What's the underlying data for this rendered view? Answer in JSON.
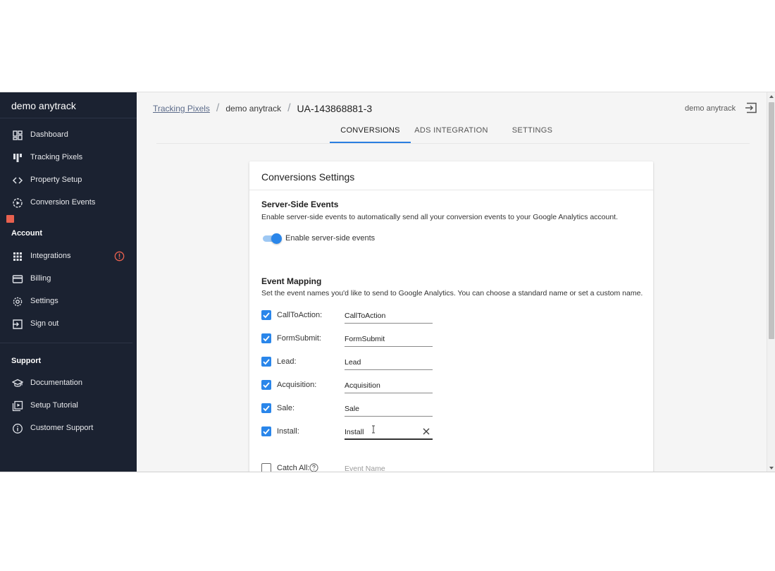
{
  "sidebar": {
    "brand": "demo anytrack",
    "nav": [
      {
        "label": "Dashboard",
        "icon": "dashboard-icon"
      },
      {
        "label": "Tracking Pixels",
        "icon": "pixel-icon"
      },
      {
        "label": "Property Setup",
        "icon": "code-icon"
      },
      {
        "label": "Conversion Events",
        "icon": "events-icon"
      }
    ],
    "account_title": "Account",
    "account": [
      {
        "label": "Integrations",
        "icon": "apps-grid-icon",
        "alert": true
      },
      {
        "label": "Billing",
        "icon": "credit-card-icon"
      },
      {
        "label": "Settings",
        "icon": "gear-icon"
      },
      {
        "label": "Sign out",
        "icon": "sign-out-icon"
      }
    ],
    "support_title": "Support",
    "support": [
      {
        "label": "Documentation",
        "icon": "graduation-cap-icon"
      },
      {
        "label": "Setup Tutorial",
        "icon": "video-library-icon"
      },
      {
        "label": "Customer Support",
        "icon": "info-icon"
      }
    ]
  },
  "header": {
    "breadcrumb": {
      "link": "Tracking Pixels",
      "middle": "demo anytrack",
      "current": "UA-143868881-3"
    },
    "user": "demo anytrack"
  },
  "tabs": [
    {
      "label": "CONVERSIONS",
      "active": true
    },
    {
      "label": "ADS INTEGRATION",
      "active": false
    },
    {
      "label": "SETTINGS",
      "active": false
    }
  ],
  "card": {
    "title": "Conversions Settings",
    "server_side": {
      "heading": "Server-Side Events",
      "description": "Enable server-side events to automatically send all your conversion events to your Google Analytics account.",
      "toggle_label": "Enable server-side events",
      "enabled": true
    },
    "mapping": {
      "heading": "Event Mapping",
      "description": "Set the event names you'd like to send to Google Analytics. You can choose a standard name or set a custom name.",
      "rows": [
        {
          "name": "CallToAction:",
          "value": "CallToAction",
          "checked": true
        },
        {
          "name": "FormSubmit:",
          "value": "FormSubmit",
          "checked": true
        },
        {
          "name": "Lead:",
          "value": "Lead",
          "checked": true
        },
        {
          "name": "Acquisition:",
          "value": "Acquisition",
          "checked": true
        },
        {
          "name": "Sale:",
          "value": "Sale",
          "checked": true
        },
        {
          "name": "Install:",
          "value": "Install",
          "checked": true
        }
      ],
      "catch_all": {
        "name": "Catch All:",
        "placeholder": "Event Name",
        "checked": false
      }
    }
  },
  "colors": {
    "sidebar_bg": "#1b2231",
    "accent": "#2a86ea",
    "alert": "#e8614f"
  }
}
